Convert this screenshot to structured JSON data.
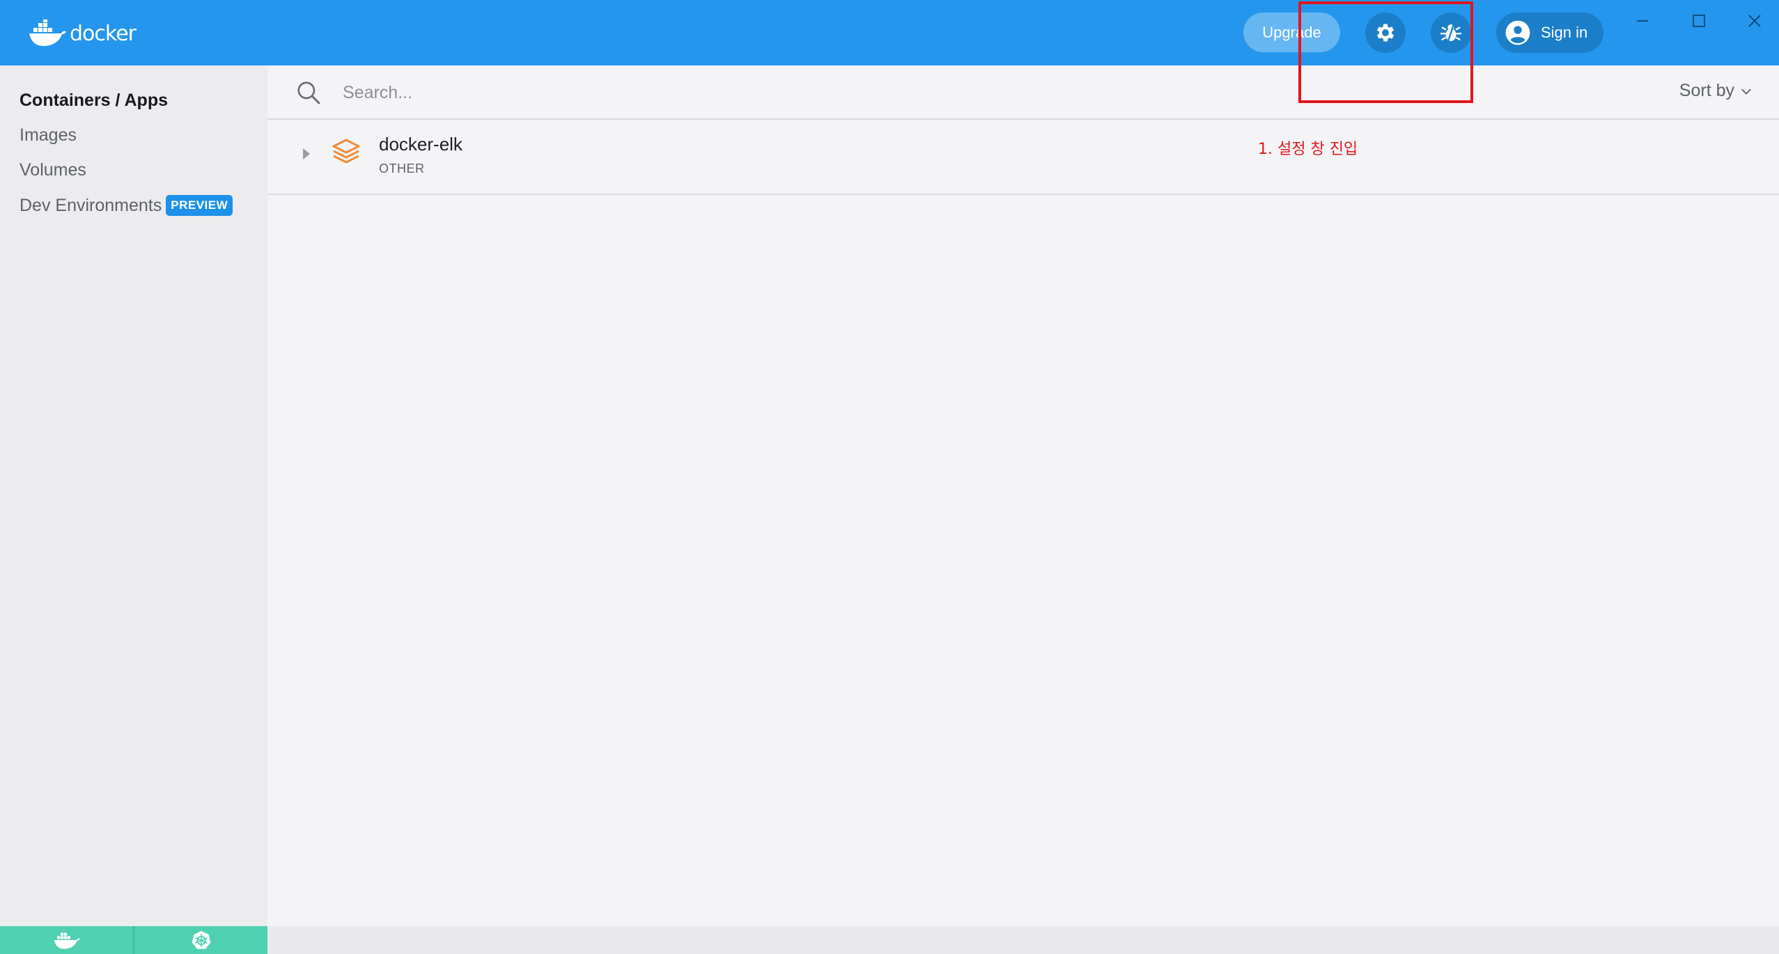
{
  "app": {
    "logo_text": "docker",
    "brand_color": "#2496ed"
  },
  "header": {
    "upgrade_label": "Upgrade",
    "settings_icon": "gear-icon",
    "troubleshoot_icon": "bug-icon",
    "signin_label": "Sign in"
  },
  "sidebar": {
    "items": [
      {
        "label": "Containers / Apps",
        "active": true
      },
      {
        "label": "Images",
        "active": false
      },
      {
        "label": "Volumes",
        "active": false
      },
      {
        "label": "Dev Environments",
        "active": false,
        "badge": "PREVIEW"
      }
    ]
  },
  "search": {
    "placeholder": "Search...",
    "value": ""
  },
  "sort": {
    "label": "Sort by"
  },
  "containers": [
    {
      "name": "docker-elk",
      "type": "OTHER",
      "icon": "stack-icon"
    }
  ],
  "annotation": {
    "text": "1. 설정 창 진입",
    "color": "#e0161e"
  },
  "statusbar": {
    "engine_icon": "whale-icon",
    "kubernetes_icon": "kubernetes-icon",
    "color": "#4fd1b1"
  }
}
